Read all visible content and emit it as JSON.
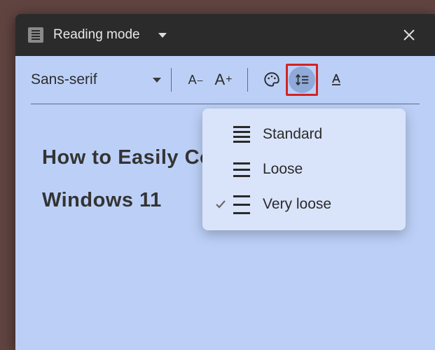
{
  "header": {
    "mode_label": "Reading mode"
  },
  "toolbar": {
    "font_family": "Sans-serif",
    "decrease_font": "A–",
    "increase_font": "A+"
  },
  "line_spacing_menu": {
    "items": [
      {
        "label": "Standard",
        "checked": false
      },
      {
        "label": "Loose",
        "checked": false
      },
      {
        "label": "Very loose",
        "checked": true
      }
    ]
  },
  "article": {
    "title": "How to Easily Compress Files on Windows 11"
  }
}
